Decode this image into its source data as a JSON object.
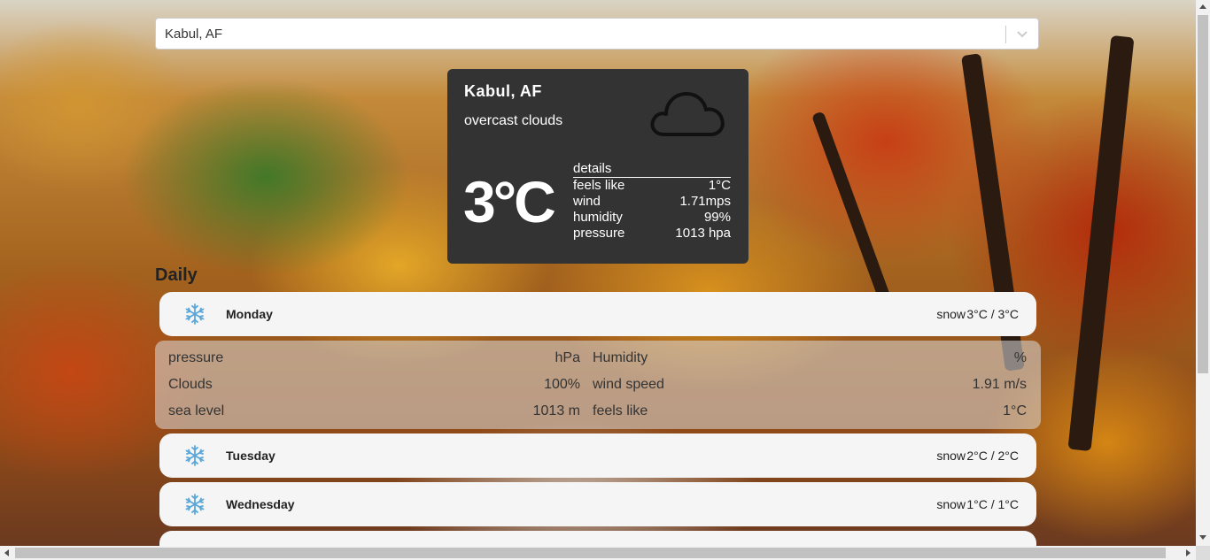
{
  "search": {
    "value": "Kabul, AF"
  },
  "current": {
    "city": "Kabul, AF",
    "description": "overcast clouds",
    "icon": "cloud-icon",
    "temperature": "3°C",
    "details_title": "details",
    "details": [
      {
        "label": "feels like",
        "value": "1°C"
      },
      {
        "label": "wind",
        "value": "1.71mps"
      },
      {
        "label": "humidity",
        "value": "99%"
      },
      {
        "label": "pressure",
        "value": "1013 hpa"
      }
    ]
  },
  "daily": {
    "title": "Daily",
    "days": [
      {
        "name": "Monday",
        "icon": "snowflake-icon",
        "desc": "snow",
        "temp": "3°C / 3°C"
      },
      {
        "name": "Tuesday",
        "icon": "snowflake-icon",
        "desc": "snow",
        "temp": "2°C / 2°C"
      },
      {
        "name": "Wednesday",
        "icon": "snowflake-icon",
        "desc": "snow",
        "temp": "1°C / 1°C"
      }
    ],
    "expanded": {
      "pressure_label": "pressure",
      "pressure_value": "hPa",
      "humidity_label": "Humidity",
      "humidity_value": "%",
      "clouds_label": "Clouds",
      "clouds_value": "100%",
      "wind_label": "wind speed",
      "wind_value": "1.91 m/s",
      "sea_label": "sea level",
      "sea_value": "1013 m",
      "feels_label": "feels like",
      "feels_value": "1°C"
    }
  },
  "colors": {
    "card": "#333333",
    "row": "#f5f5f5",
    "snow_icon": "#5aa7d8"
  }
}
